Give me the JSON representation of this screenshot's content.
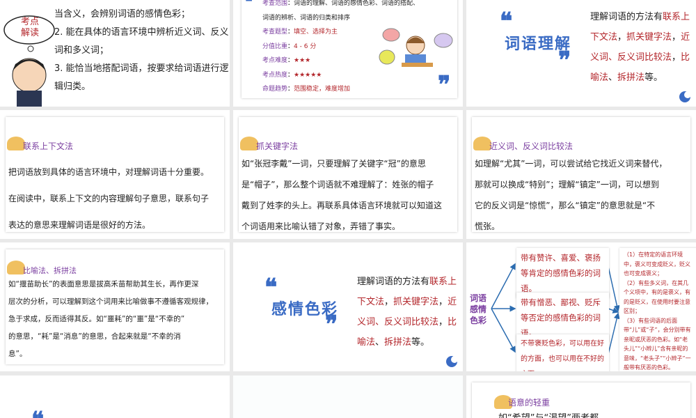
{
  "slides": [
    {
      "id": 1,
      "bubble": "考点解读",
      "lines": [
        "当含义，会辨别词语的感情色彩；",
        "2. 能在具体的语言环境中辨析近义词、反义",
        "词和多义词；",
        "3. 能恰当地搭配词语，按要求给词语进行逻",
        "辑归类。"
      ]
    },
    {
      "id": 2,
      "rows": [
        {
          "label": "考查范围",
          "value": "词语的理解、词语的感情色彩、词语的搭配、"
        },
        {
          "label": "",
          "value": "词语的辨析、词语的归类和排序"
        },
        {
          "label": "考查题型",
          "value": "填空、选择为主"
        },
        {
          "label": "分值比重",
          "value": "4 - 6 分"
        },
        {
          "label": "考点难度",
          "value": "★★★"
        },
        {
          "label": "考点热度",
          "value": "★★★★★"
        },
        {
          "label": "命题趋势",
          "value": "范围稳定，难度增加"
        }
      ]
    },
    {
      "id": 3,
      "title": "词语理解",
      "lead": "理解词语的方法有",
      "methods": [
        "联系上下文法",
        "抓关键字法",
        "近义词、反义词比较法",
        "比喻法",
        "拆拼法"
      ],
      "end": "等。"
    },
    {
      "id": 4,
      "heading": "联系上下文法",
      "lines": [
        "把词语放到具体的语言环境中，对理解词语十分重要。",
        "在阅读中，联系上下文的内容理解句子意思，联系句子",
        "表达的意思来理解词语是很好的方法。"
      ]
    },
    {
      "id": 5,
      "heading": "抓关键字法",
      "lines": [
        "如“张冠李戴”一词，只要理解了关键字“冠”的意思",
        "是“帽子”，那么整个词语就不难理解了：姓张的帽子",
        "戴到了姓李的头上。再联系具体语言环境就可以知道这",
        "个词语用来比喻认错了对象，弄错了事实。"
      ]
    },
    {
      "id": 6,
      "heading": "近义词、反义词比较法",
      "lines": [
        "如理解“尤其”一词，可以尝试给它找近义词来替代，",
        "那就可以换成“特别”；理解“镇定”一词，可以想到",
        "它的反义词是“惊慌”，那么“镇定”的意思就是“不",
        "慌张。"
      ]
    },
    {
      "id": 7,
      "heading": "比喻法、拆拼法",
      "lines": [
        "如“揠苗助长”的表面意思是拔高禾苗帮助其生长，再作更深",
        "层次的分析，可以理解到这个词用来比喻做事不遵循客观规律，",
        "急于求成，反而适得其反。如“噩耗”的“噩”是“不幸的”",
        "的意思，“耗”是“消息”的意思，合起来就是“不幸的消",
        "息”。"
      ]
    },
    {
      "id": 8,
      "title": "感情色彩",
      "lead": "理解词语的方法有",
      "methods": [
        "联系上下文法",
        "抓关键字法",
        "近义词、反义词比较法",
        "比喻法",
        "拆拼法"
      ],
      "end": "等。"
    },
    {
      "id": 9,
      "root": "词语感情色彩",
      "branches": [
        "带有赞许、喜爱、褒扬等肯定的感情色彩的词语。",
        "带有憎恶、鄙视、贬斥等否定的感情色彩的词语。",
        "不带褒贬色彩，可以用在好的方面，也可以用在不好的方面。"
      ],
      "notes": [
        "（1）在特定的语言环境中，褒义可变成贬义，贬义也可变成褒义；",
        "（2）有些多义词，在其几个义项中，有的是褒义，有的是贬义，在使用时要注意区别；",
        "（3）有些词语的后面带“儿”或“子”，会分别带有亲昵或厌恶的色彩。如“老头儿”“小辫儿”含有亲昵的意味，“老头子”“小辫子”一般带有厌恶的色彩。"
      ]
    },
    {
      "id": 12,
      "heading": "语意的轻重",
      "lines": [
        "如“希望”与“渴望”两者都"
      ]
    }
  ],
  "colors": {
    "accent": "#3a6bc4",
    "red": "#b3262b",
    "purple": "#7b3fa0"
  }
}
